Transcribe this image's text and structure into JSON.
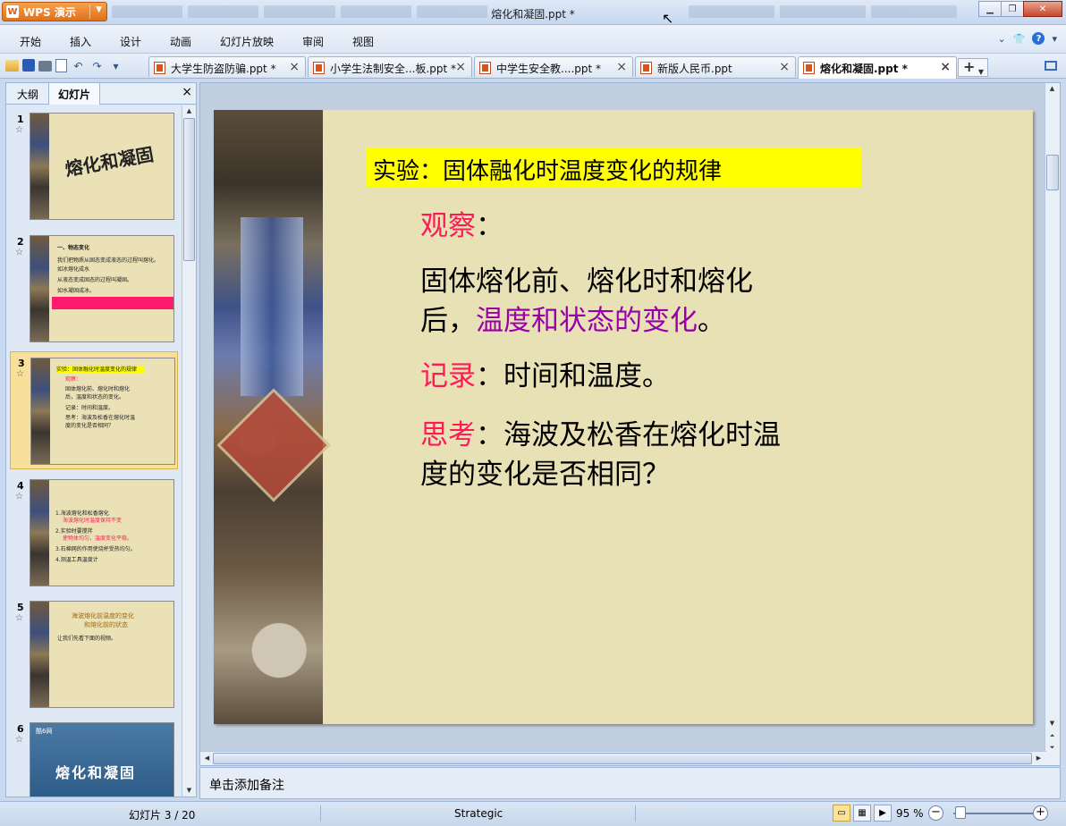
{
  "window": {
    "app_button": "WPS 演示",
    "title": "熔化和凝固.ppt *"
  },
  "menu": [
    "开始",
    "插入",
    "设计",
    "动画",
    "幻灯片放映",
    "审阅",
    "视图"
  ],
  "doc_tabs": [
    "大学生防盗防骗.ppt *",
    "小学生法制安全...板.ppt *",
    "中学生安全教....ppt *",
    "新版人民币.ppt",
    "熔化和凝固.ppt *"
  ],
  "left_panel": {
    "tab_outline": "大纲",
    "tab_slides": "幻灯片"
  },
  "thumbnails": [
    {
      "num": "1",
      "title": "熔化和凝固"
    },
    {
      "num": "2",
      "lines": [
        "一、物态变化",
        "我们把物质从固态变成液态的过程叫熔化。",
        "如冰熔化成水",
        "从液态变成固态的过程叫凝固。",
        "如水凝固成冰。"
      ]
    },
    {
      "num": "3",
      "lines": [
        "实验：固体融化时温度变化的规律",
        "观察：",
        "固体熔化前、熔化时和熔化",
        "后，温度和状态的变化。",
        "记录：时间和温度。",
        "思考：海波及松香在熔化时温",
        "度的变化是否相同？"
      ]
    },
    {
      "num": "4",
      "lines": [
        "1.海波熔化和松香熔化",
        "海波熔化时温度保持不变",
        "2.实验时要搅拌",
        "使物体均匀，温度变化平稳。",
        "3.石棉网的作用使烧杯受热均匀。",
        "4.测温工具温度计"
      ]
    },
    {
      "num": "5",
      "lines": [
        "海波熔化前温度的变化",
        "和熔化前的状态",
        "让我们先看下面的视频。"
      ]
    },
    {
      "num": "6",
      "logo": "酷6网",
      "title": "熔化和凝固"
    }
  ],
  "slide": {
    "heading": "实验：固体融化时温度变化的规律",
    "observe_label": "观察",
    "observe_colon": "：",
    "observe_text_1": "固体熔化前、熔化时和熔化",
    "observe_text_2a": "后，",
    "observe_text_2b": "温度和状态的变化",
    "observe_text_2c": "。",
    "record_label": "记录",
    "record_text": "：时间和温度。",
    "think_label": "思考",
    "think_text_1": "：海波及松香在熔化时温",
    "think_text_2": "度的变化是否相同？"
  },
  "notes_placeholder": "单击添加备注",
  "status": {
    "slide_counter": "幻灯片 3 / 20",
    "theme": "Strategic",
    "zoom": "95 %"
  },
  "colors": {
    "highlight_yellow": "#ffff00",
    "label_red": "#ff1a56",
    "emphasis_purple": "#9900aa",
    "slide_bg": "#e9e1b6"
  }
}
